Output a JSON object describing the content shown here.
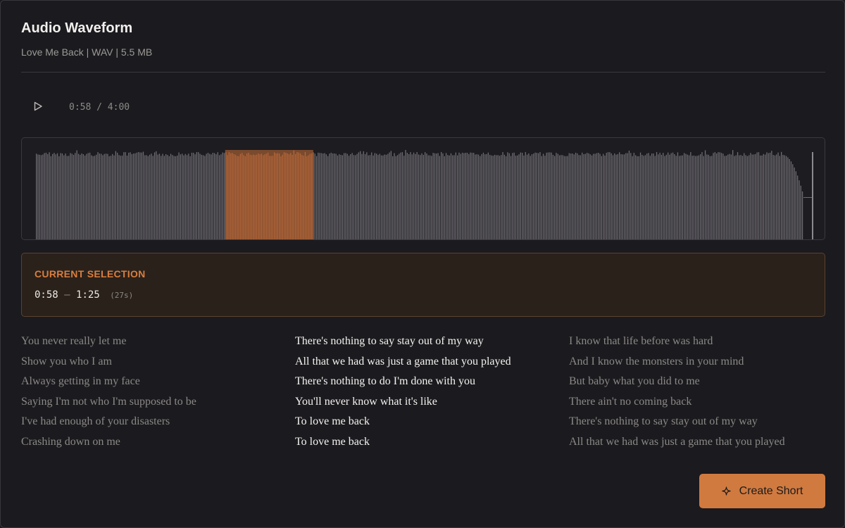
{
  "header": {
    "title": "Audio Waveform",
    "file_info": "Love Me Back | WAV | 5.5 MB"
  },
  "player": {
    "play_icon": "play-icon",
    "time": "0:58 / 4:00",
    "position_seconds": 58,
    "duration_seconds": 240
  },
  "waveform": {
    "selection_start_seconds": 58,
    "selection_end_seconds": 85,
    "colors": {
      "bar": "#6e6d72",
      "selected_bar": "#b5673a",
      "selection_fill": "#7a4a2e",
      "border": "#3a393e"
    }
  },
  "selection": {
    "label": "CURRENT SELECTION",
    "start": "0:58",
    "separator": "–",
    "end": "1:25",
    "duration": "(27s)"
  },
  "lyrics": {
    "before": [
      "You never really let me",
      "Show you who I am",
      "Always getting in my face",
      "Saying I'm not who I'm supposed to be",
      "I've had enough of your disasters",
      "Crashing down on me"
    ],
    "current": [
      "There's nothing to say stay out of my way",
      "All that we had was just a game that you played",
      "There's nothing to do I'm done with you",
      "You'll never know what it's like",
      "To love me back",
      "To love me back"
    ],
    "after": [
      "I know that life before was hard",
      "And I know the monsters in your mind",
      "But baby what you did to me",
      "There ain't no coming back",
      "There's nothing to say stay out of my way",
      "All that we had was just a game that you played"
    ]
  },
  "actions": {
    "create_short_label": "Create Short",
    "create_short_icon": "sparkle-icon",
    "accent": "#d07a40"
  }
}
